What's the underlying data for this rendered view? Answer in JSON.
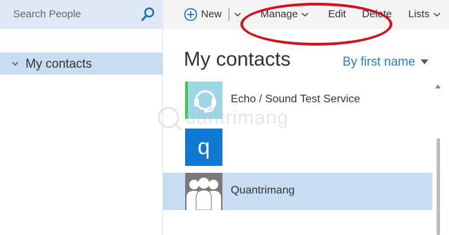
{
  "search": {
    "placeholder": "Search People",
    "icon": "search-icon"
  },
  "sidebar": {
    "folders": [
      {
        "label": "My contacts",
        "expanded": true
      }
    ]
  },
  "toolbar": {
    "new_label": "New",
    "manage_label": "Manage",
    "edit_label": "Edit",
    "delete_label": "Delete",
    "lists_label": "Lists"
  },
  "main": {
    "title": "My contacts",
    "sort_label": "By first name",
    "contacts": [
      {
        "name": "Echo / Sound Test Service",
        "avatar": "headset-icon",
        "color": "#9fd6e6",
        "presence": "#3ec84b"
      },
      {
        "name": "",
        "avatar": "q",
        "color": "#0f78d0"
      },
      {
        "name": "Quantrimang",
        "avatar": "group-icon",
        "color": "#7a7a7a",
        "selected": true
      }
    ]
  },
  "watermark": {
    "text": "uantrimang"
  },
  "colors": {
    "accent": "#2e7cc4",
    "selection": "#c9ddf2",
    "highlight_oval": "#d4121f"
  }
}
